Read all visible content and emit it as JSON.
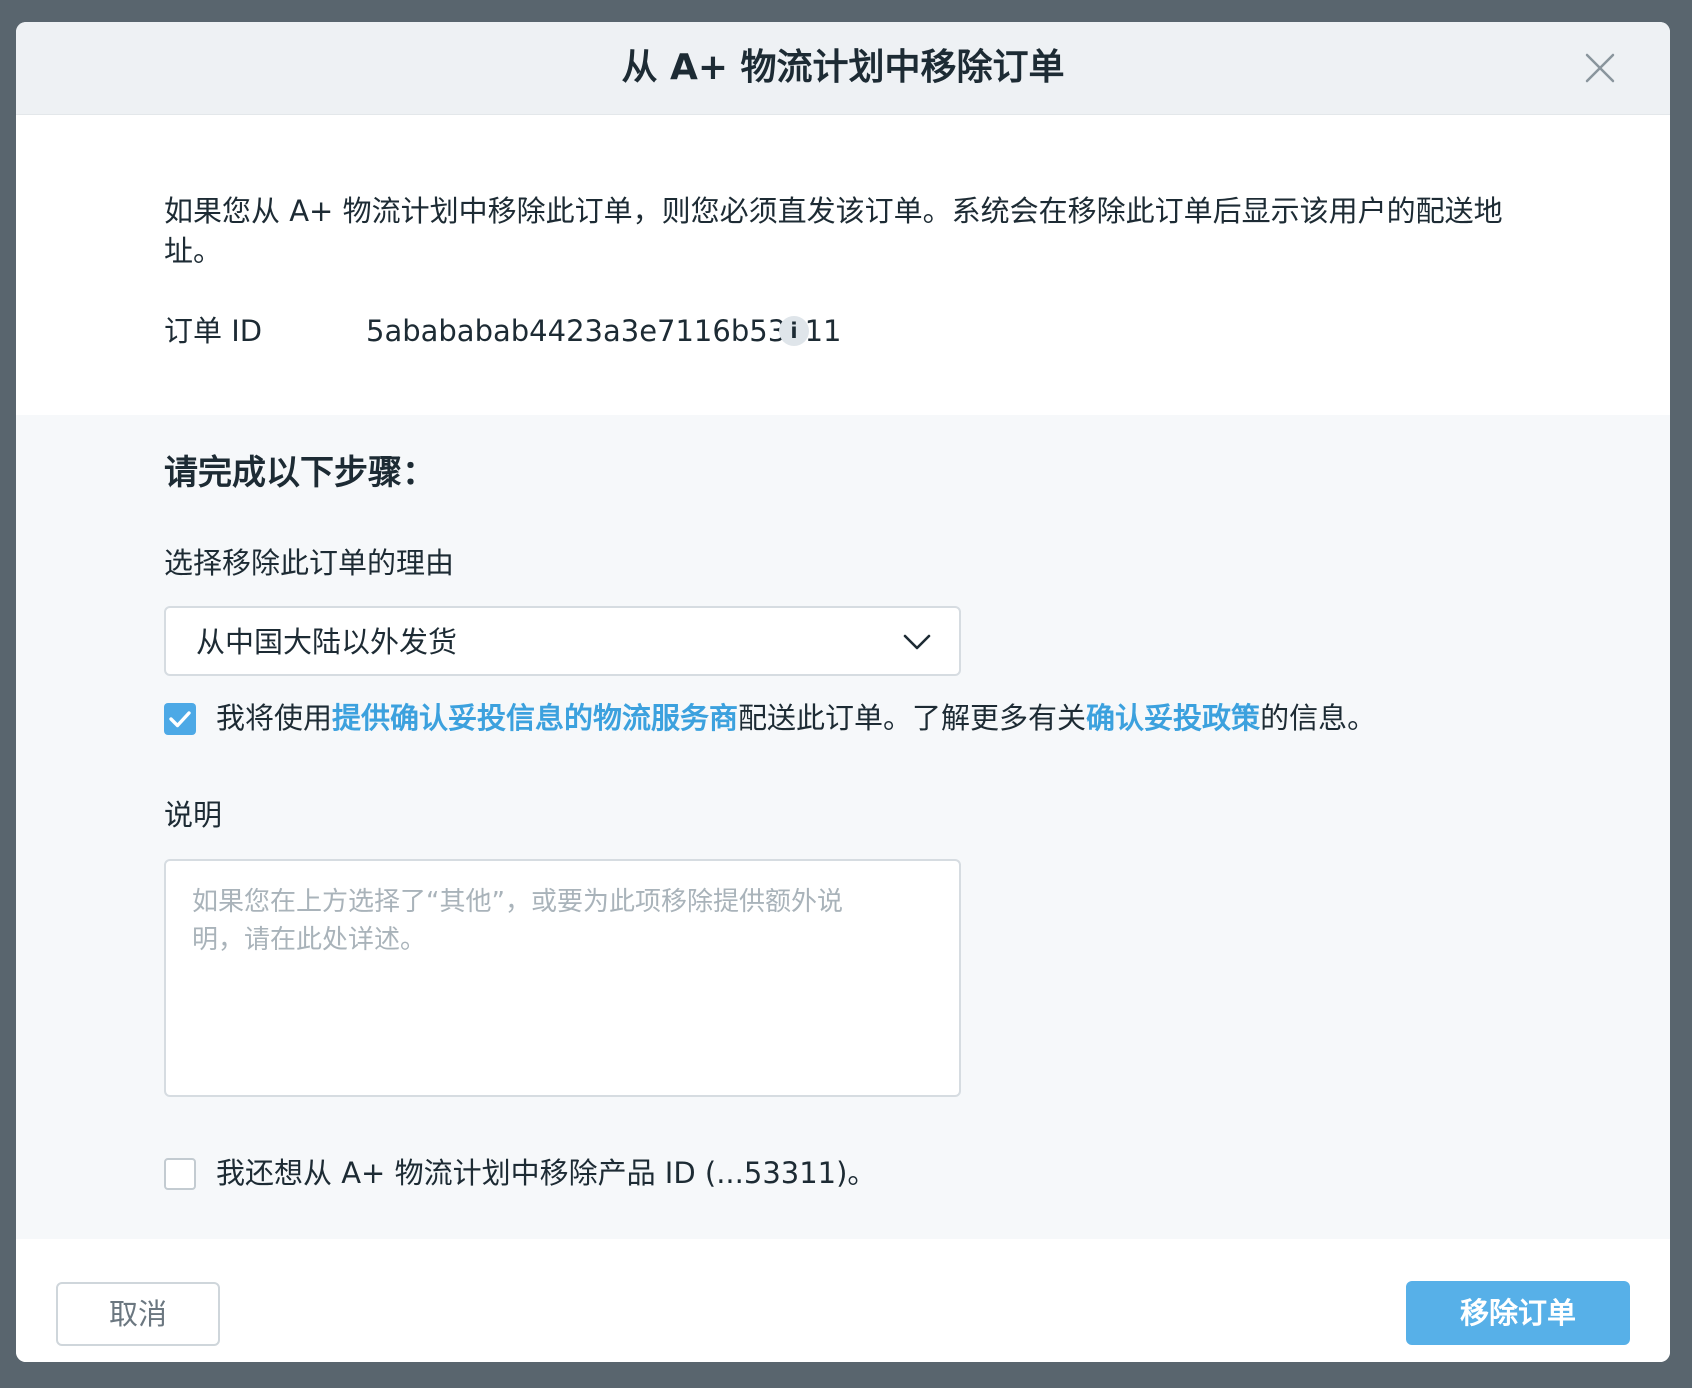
{
  "dialog": {
    "title": "从 A+ 物流计划中移除订单",
    "close_icon": "close-icon",
    "intro": "如果您从 A+ 物流计划中移除此订单，则您必须直发该订单。系统会在移除此订单后显示该用户的配送地址。",
    "order_id_label": "订单 ID",
    "order_id_value": "5abababab4423a3e7116b53311",
    "info_icon_glyph": "i"
  },
  "steps": {
    "heading": "请完成以下步骤：",
    "reason_label": "选择移除此订单的理由",
    "reason_selected": "从中国大陆以外发货",
    "confirm": {
      "checked": true,
      "prefix": "我将使用",
      "link1": "提供确认妥投信息的物流服务商",
      "middle": "配送此订单。了解更多有关",
      "link2": "确认妥投政策",
      "suffix": "的信息。"
    },
    "notes_label": "说明",
    "notes_placeholder": "如果您在上方选择了“其他”，或要为此项移除提供额外说明，请在此处详述。",
    "remove_product": {
      "checked": false,
      "text": "我还想从 A+ 物流计划中移除产品 ID (...53311)。"
    }
  },
  "footer": {
    "cancel_label": "取消",
    "remove_label": "移除订单"
  },
  "colors": {
    "accent": "#4da9e6",
    "link": "#3ca1de",
    "primary_button": "#57b0e8",
    "backdrop": "#59656e"
  }
}
